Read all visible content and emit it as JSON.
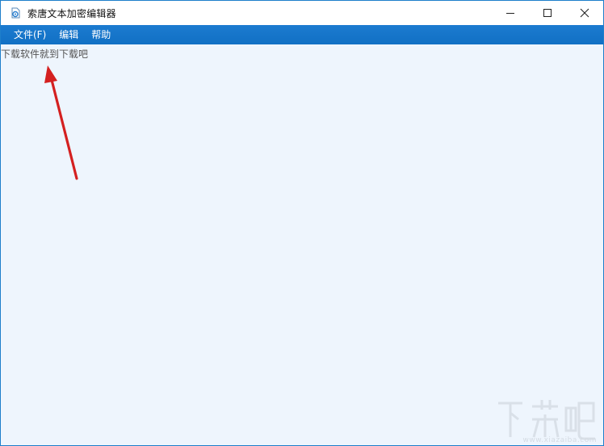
{
  "window": {
    "title": "索唐文本加密编辑器",
    "controls": {
      "minimize": "minimize-icon",
      "maximize": "maximize-icon",
      "close": "close-icon"
    }
  },
  "menu": {
    "items": [
      {
        "label": "文件(F)"
      },
      {
        "label": "编辑"
      },
      {
        "label": "帮助"
      }
    ]
  },
  "editor": {
    "content": "下载软件就到下载吧"
  },
  "watermark": {
    "brand": "下载吧",
    "url": "www.xiazaiba.com"
  },
  "colors": {
    "accent": "#1170c4",
    "editor_bg": "#eef5fd",
    "annotation": "#d42020"
  }
}
